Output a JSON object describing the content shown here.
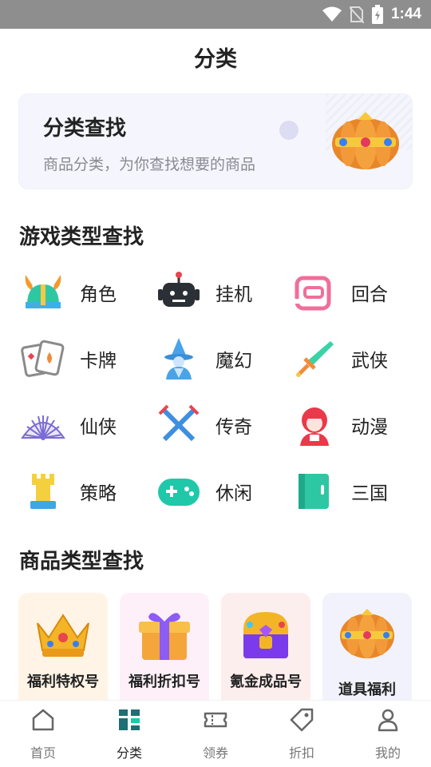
{
  "status_bar": {
    "time": "1:44"
  },
  "header": {
    "title": "分类"
  },
  "banner": {
    "title": "分类查找",
    "subtitle": "商品分类，为你查找想要的商品"
  },
  "game_section": {
    "title": "游戏类型查找",
    "items": [
      {
        "label": "角色",
        "icon": "viking-helmet-icon"
      },
      {
        "label": "挂机",
        "icon": "robot-icon"
      },
      {
        "label": "回合",
        "icon": "turn-icon"
      },
      {
        "label": "卡牌",
        "icon": "playing-cards-icon"
      },
      {
        "label": "魔幻",
        "icon": "wizard-icon"
      },
      {
        "label": "武侠",
        "icon": "sword-icon"
      },
      {
        "label": "仙侠",
        "icon": "folding-fan-icon"
      },
      {
        "label": "传奇",
        "icon": "crossed-swords-icon"
      },
      {
        "label": "动漫",
        "icon": "anime-girl-icon"
      },
      {
        "label": "策略",
        "icon": "chess-rook-icon"
      },
      {
        "label": "休闲",
        "icon": "gamepad-icon"
      },
      {
        "label": "三国",
        "icon": "book-icon"
      }
    ]
  },
  "product_section": {
    "title": "商品类型查找",
    "items": [
      {
        "label": "福利特权号",
        "icon": "crown-icon",
        "bg": "#fff4e6"
      },
      {
        "label": "福利折扣号",
        "icon": "gift-box-icon",
        "bg": "#fdf0f9"
      },
      {
        "label": "氪金成品号",
        "icon": "treasure-chest-icon",
        "bg": "#fdeeee"
      },
      {
        "label": "道具福利",
        "icon": "pumpkin-chest-icon",
        "bg": "#f2f2fc"
      }
    ]
  },
  "bottom_nav": {
    "items": [
      {
        "label": "首页",
        "icon": "home-icon"
      },
      {
        "label": "分类",
        "icon": "category-icon",
        "active": true
      },
      {
        "label": "领券",
        "icon": "ticket-icon"
      },
      {
        "label": "折扣",
        "icon": "tag-icon"
      },
      {
        "label": "我的",
        "icon": "user-icon"
      }
    ]
  },
  "colors": {
    "accent": "#1fc8a8",
    "text": "#222222",
    "muted": "#777777",
    "banner_bg": "#f5f6fd"
  }
}
